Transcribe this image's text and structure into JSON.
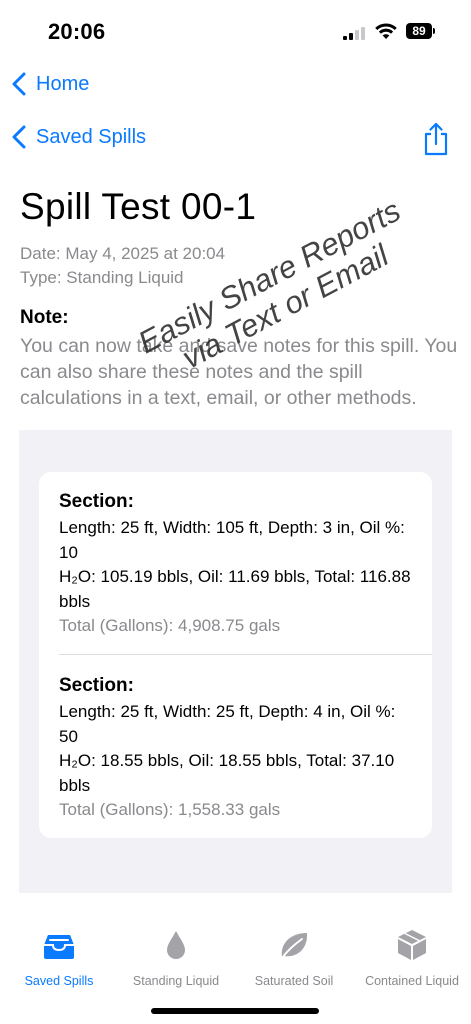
{
  "status": {
    "time": "20:06",
    "battery": "89"
  },
  "nav": {
    "back_home": "Home",
    "back_saved": "Saved Spills"
  },
  "spill": {
    "title": "Spill Test 00-1",
    "date": "Date: May 4, 2025 at 20:04",
    "type": "Type: Standing Liquid",
    "note_label": "Note:",
    "note_text": "You can now take and save notes for this spill. You can also share these notes and the spill calculations in a text, email, or other methods."
  },
  "watermark": {
    "line1": "Easily Share Reports",
    "line2": "via Text or Email"
  },
  "sections": [
    {
      "heading": "Section:",
      "dims": "Length: 25 ft, Width: 105 ft, Depth: 3 in, Oil %: 10",
      "volumes": "H₂O: 105.19 bbls, Oil: 11.69 bbls, Total: 116.88 bbls",
      "gallons": "Total (Gallons): 4,908.75 gals"
    },
    {
      "heading": "Section:",
      "dims": "Length: 25 ft, Width: 25 ft, Depth: 4 in, Oil %: 50",
      "volumes": "H₂O: 18.55 bbls, Oil: 18.55 bbls, Total: 37.10 bbls",
      "gallons": "Total (Gallons): 1,558.33 gals"
    }
  ],
  "tabs": [
    {
      "label": "Saved Spills",
      "icon": "tray-icon",
      "active": true
    },
    {
      "label": "Standing Liquid",
      "icon": "drop-icon",
      "active": false
    },
    {
      "label": "Saturated Soil",
      "icon": "leaf-icon",
      "active": false
    },
    {
      "label": "Contained Liquid",
      "icon": "box-icon",
      "active": false
    }
  ],
  "colors": {
    "accent": "#0a7aff",
    "secondary_text": "#8a8a8e",
    "list_bg": "#f1f1f6",
    "inactive_icon": "#a3a3a8"
  }
}
